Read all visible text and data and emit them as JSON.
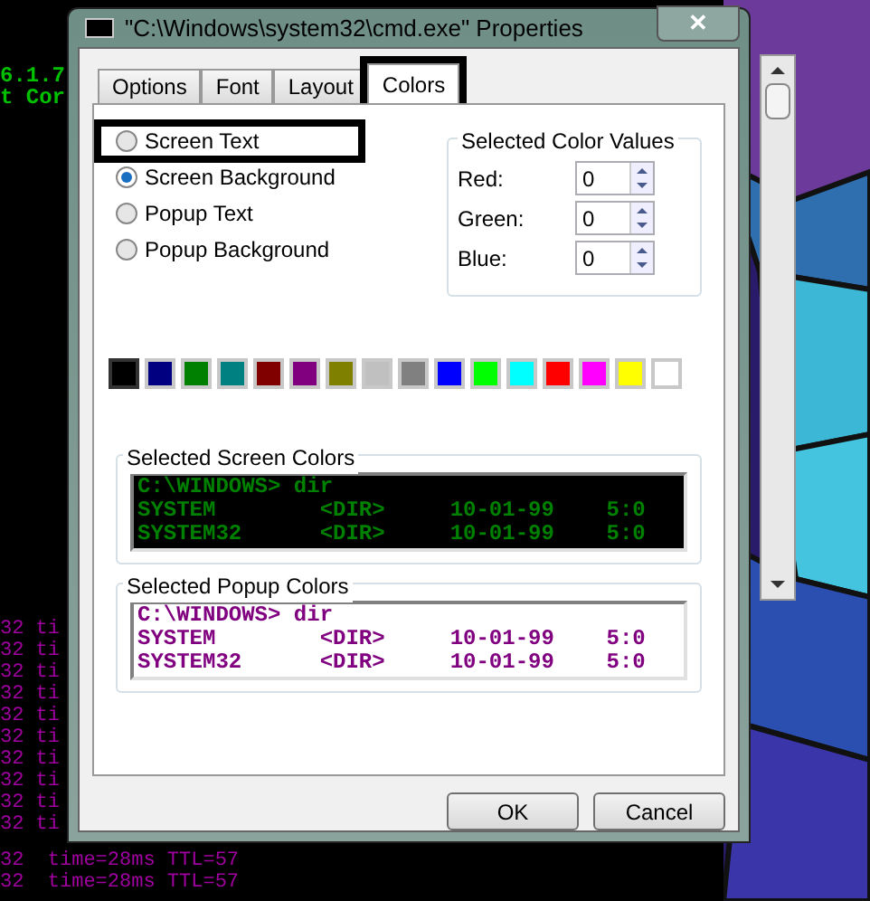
{
  "console": {
    "green_lines": [
      "6.1.7",
      "t Cor"
    ],
    "clipped_lines": [
      "32 ti",
      "32 ti",
      "32 ti",
      "32 ti",
      "32 ti",
      "32 ti",
      "32 ti",
      "32 ti",
      "32 ti",
      "32 ti"
    ],
    "full_lines": [
      "32  time=28ms TTL=57",
      "32  time=28ms TTL=57"
    ]
  },
  "window": {
    "title": "\"C:\\Windows\\system32\\cmd.exe\" Properties",
    "close": "✕"
  },
  "tabs": [
    {
      "label": "Options",
      "selected": false,
      "highlighted": false
    },
    {
      "label": "Font",
      "selected": false,
      "highlighted": false
    },
    {
      "label": "Layout",
      "selected": false,
      "highlighted": false
    },
    {
      "label": "Colors",
      "selected": true,
      "highlighted": true
    }
  ],
  "targets": [
    {
      "label": "Screen Text",
      "selected": false,
      "highlighted": true
    },
    {
      "label": "Screen Background",
      "selected": true,
      "highlighted": false
    },
    {
      "label": "Popup Text",
      "selected": false,
      "highlighted": false
    },
    {
      "label": "Popup Background",
      "selected": false,
      "highlighted": false
    }
  ],
  "color_values": {
    "title": "Selected Color Values",
    "fields": [
      {
        "label": "Red:",
        "value": "0"
      },
      {
        "label": "Green:",
        "value": "0"
      },
      {
        "label": "Blue:",
        "value": "0"
      }
    ]
  },
  "palette": [
    {
      "color": "#000000",
      "selected": true
    },
    {
      "color": "#000080",
      "selected": false
    },
    {
      "color": "#008000",
      "selected": false
    },
    {
      "color": "#008080",
      "selected": false
    },
    {
      "color": "#800000",
      "selected": false
    },
    {
      "color": "#800080",
      "selected": false
    },
    {
      "color": "#808000",
      "selected": false
    },
    {
      "color": "#c0c0c0",
      "selected": false
    },
    {
      "color": "#808080",
      "selected": false
    },
    {
      "color": "#0000ff",
      "selected": false
    },
    {
      "color": "#00ff00",
      "selected": false
    },
    {
      "color": "#00ffff",
      "selected": false
    },
    {
      "color": "#ff0000",
      "selected": false
    },
    {
      "color": "#ff00ff",
      "selected": false
    },
    {
      "color": "#ffff00",
      "selected": false
    },
    {
      "color": "#ffffff",
      "selected": false
    }
  ],
  "previews": [
    {
      "title": "Selected Screen Colors",
      "kind": "screen",
      "color": "#008000",
      "lines": [
        "C:\\WINDOWS> dir",
        "SYSTEM        <DIR>     10-01-99    5:0",
        "SYSTEM32      <DIR>     10-01-99    5:0"
      ]
    },
    {
      "title": "Selected Popup Colors",
      "kind": "popup",
      "color": "#800080",
      "lines": [
        "C:\\WINDOWS> dir",
        "SYSTEM        <DIR>     10-01-99    5:0",
        "SYSTEM32      <DIR>     10-01-99    5:0"
      ]
    }
  ],
  "buttons": [
    "OK",
    "Cancel"
  ]
}
